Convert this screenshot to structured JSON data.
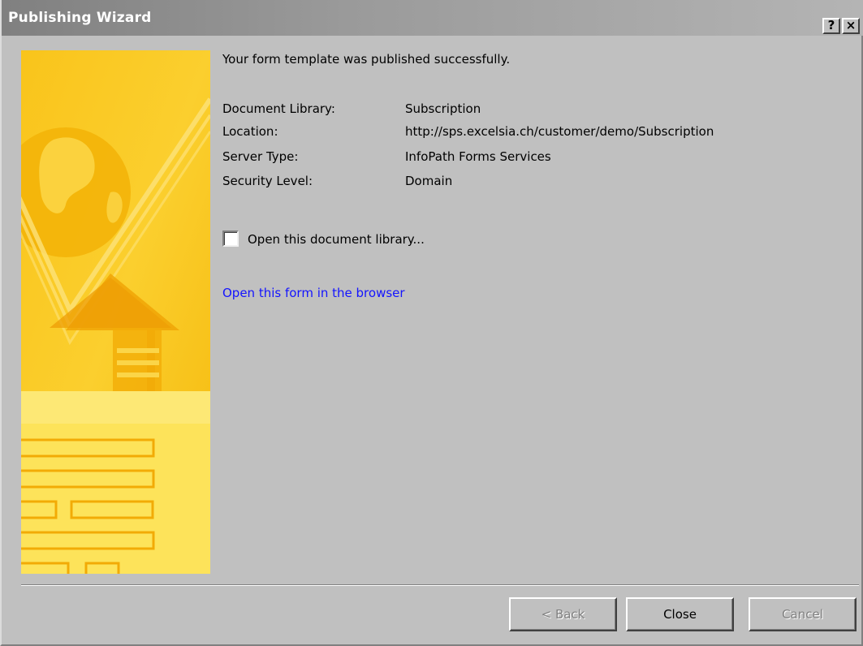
{
  "window": {
    "title": "Publishing Wizard",
    "help_button": "?",
    "close_button": "×"
  },
  "main": {
    "message": "Your form template was published successfully.",
    "details": [
      {
        "label": "Document Library:",
        "value": "Subscription"
      },
      {
        "label": "Location:",
        "value": "http://sps.excelsia.ch/customer/demo/Subscription"
      },
      {
        "label": "Server Type:",
        "value": "InfoPath Forms Services"
      },
      {
        "label": "Security Level:",
        "value": "Domain"
      }
    ],
    "checkbox": {
      "label": "Open this document library...",
      "checked": false
    },
    "link": "Open this form in the browser"
  },
  "buttons": {
    "back": "< Back",
    "close": "Close",
    "cancel": "Cancel"
  },
  "icons": {
    "banner": "publishing-wizard-banner",
    "help": "help-icon",
    "close": "close-icon"
  },
  "colors": {
    "banner_yellow": "#f7c31a",
    "link_blue": "#1414ff",
    "dialog_gray": "#c0c0c0"
  }
}
